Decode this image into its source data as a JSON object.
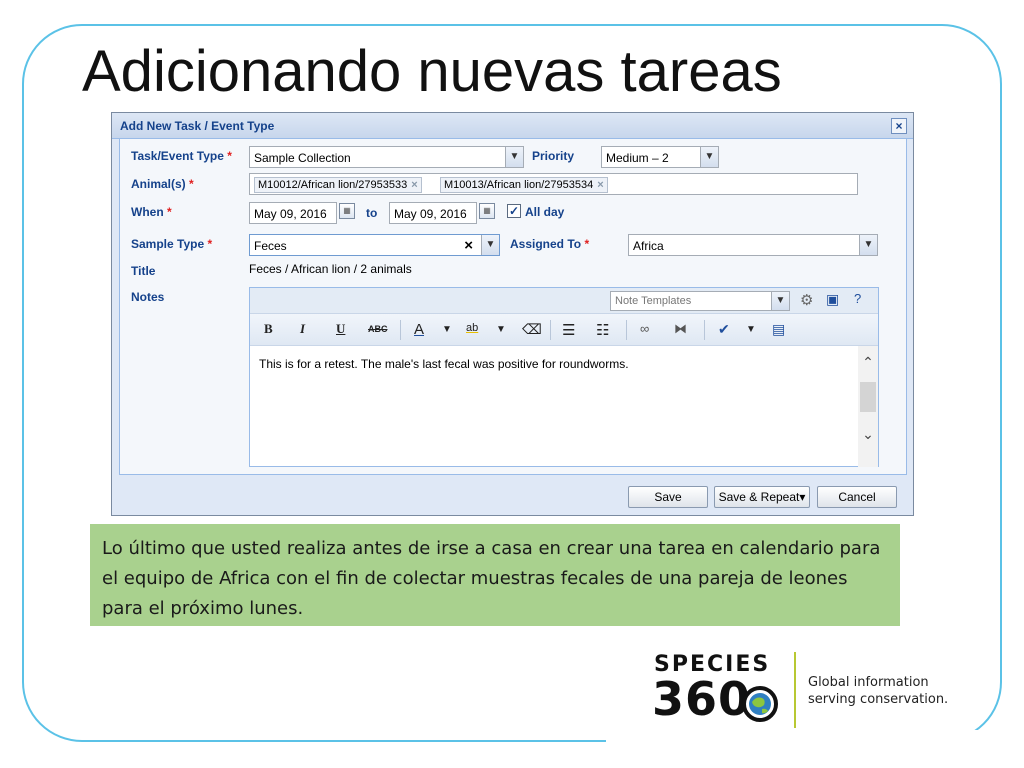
{
  "slide": {
    "title": "Adicionando nuevas tareas",
    "note": "Lo último que usted realiza antes de irse a casa en crear una tarea en calendario para el equipo de Africa con el fin de colectar muestras fecales de una pareja de leones para el próximo lunes."
  },
  "dialog": {
    "title": "Add New Task / Event Type",
    "close_label": "×",
    "fields": {
      "task_type": {
        "label": "Task/Event Type",
        "required": "*",
        "value": "Sample Collection"
      },
      "priority": {
        "label": "Priority",
        "value": "Medium – 2"
      },
      "animals": {
        "label": "Animal(s)",
        "required": "*",
        "tags": [
          "M10012/African lion/27953533",
          "M10013/African lion/27953534"
        ],
        "remove": "×"
      },
      "when": {
        "label": "When",
        "required": "*",
        "from": "May 09, 2016",
        "to_label": "to",
        "to": "May 09, 2016"
      },
      "all_day": {
        "label": "All day",
        "checked": "✓"
      },
      "sample_type": {
        "label": "Sample Type",
        "required": "*",
        "value": "Feces",
        "clear": "×"
      },
      "assigned_to": {
        "label": "Assigned To",
        "required": "*",
        "value": "Africa"
      },
      "title": {
        "label": "Title",
        "value": "Feces / African lion / 2 animals"
      },
      "notes": {
        "label": "Notes",
        "template_placeholder": "Note Templates",
        "text": "This is for a retest. The male's last fecal was positive for roundworms."
      }
    },
    "toolbar": {
      "bold": "B",
      "italic": "I",
      "underline": "U",
      "strike": "ABC",
      "font_color": "A",
      "highlight": "ab"
    },
    "buttons": {
      "save": "Save",
      "save_repeat": "Save & Repeat▾",
      "cancel": "Cancel"
    }
  },
  "logo": {
    "word": "SPECIES",
    "number": "360",
    "tagline_1": "Global information",
    "tagline_2": "serving conservation."
  },
  "colors": {
    "frame": "#5bc2e7",
    "note_bg": "#a9d18e",
    "label": "#15428b",
    "accent_divider": "#b8c832"
  }
}
